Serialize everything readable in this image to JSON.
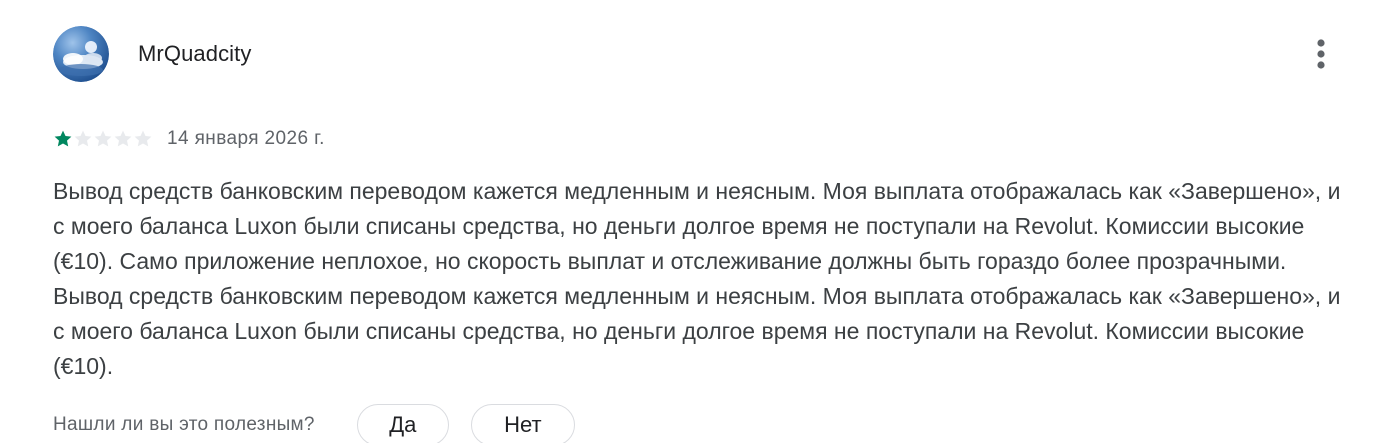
{
  "review": {
    "author": "MrQuadcity",
    "avatar_icon": "avatar-sky-icon",
    "menu_icon": "more-vert-icon",
    "rating": {
      "value": 1,
      "max": 5,
      "filled_color": "#01875f",
      "empty_color": "#e8eaed"
    },
    "date": "14 января 2026 г.",
    "text": "Вывод средств банковским переводом кажется медленным и неясным. Моя выплата отображалась как «Завершено», и с моего баланса Luxon были списаны средства, но деньги долгое время не поступали на Revolut. Комиссии высокие (€10). Само приложение неплохое, но скорость выплат и отслеживание должны быть гораздо более прозрачными. Вывод средств банковским переводом кажется медленным и неясным. Моя выплата отображалась как «Завершено», и с моего баланса Luxon были списаны средства, но деньги долгое время не поступали на Revolut. Комиссии высокие (€10).",
    "helpful": {
      "question": "Нашли ли вы это полезным?",
      "yes_label": "Да",
      "no_label": "Нет"
    }
  }
}
